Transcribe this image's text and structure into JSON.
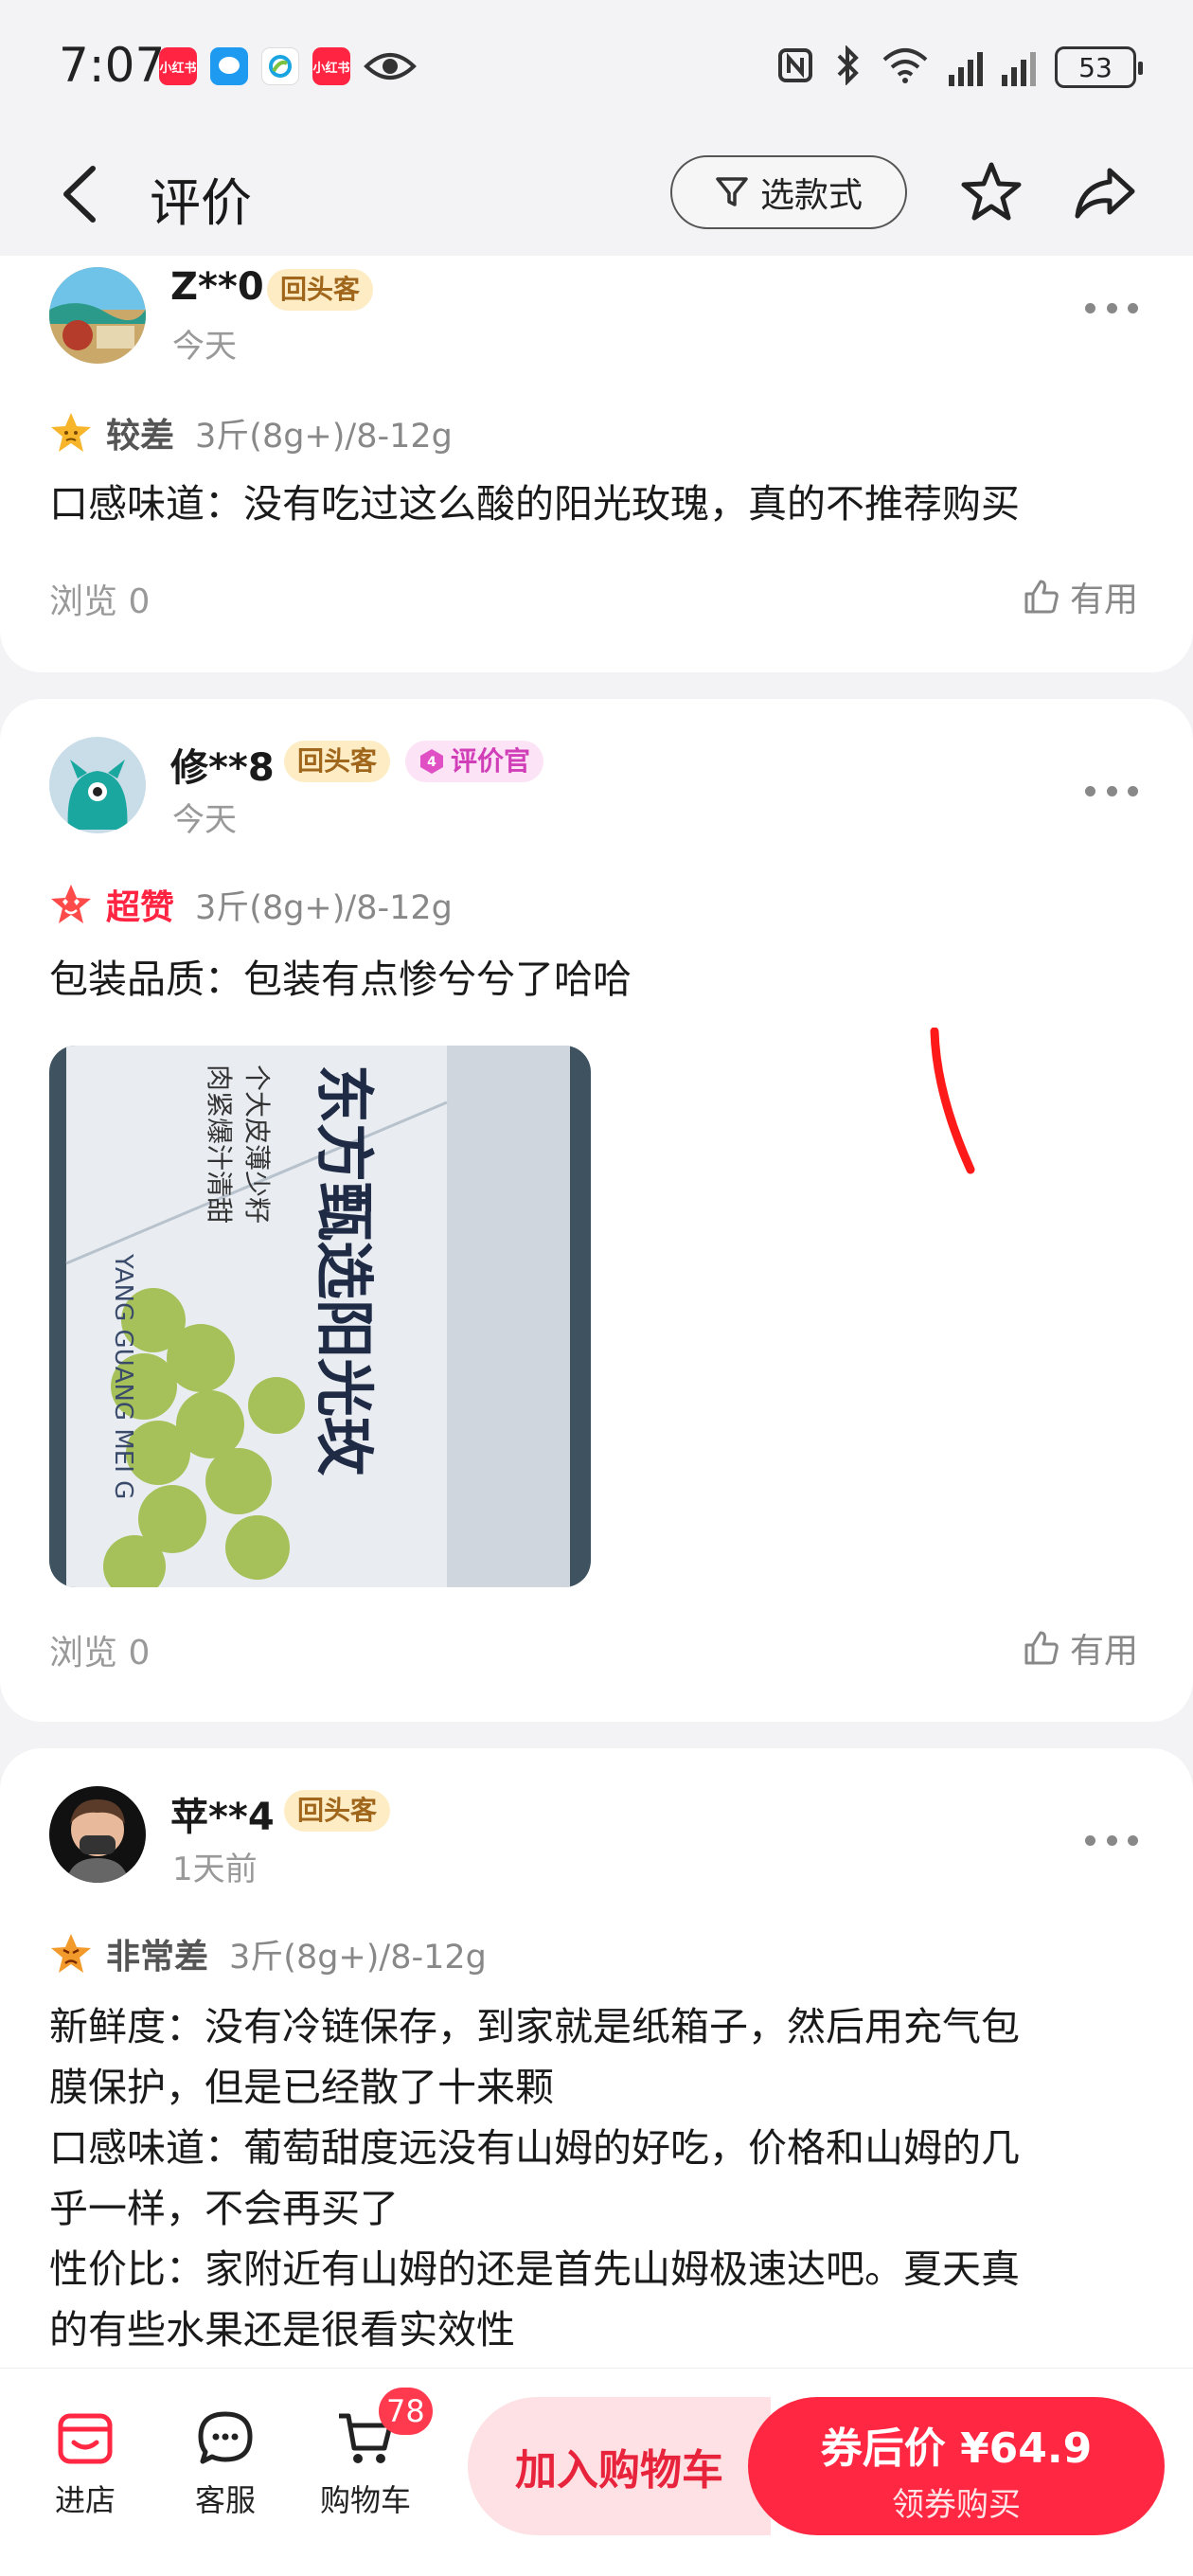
{
  "status_bar": {
    "time": "7:07",
    "app_icons": [
      {
        "name": "xiaohongshu-icon",
        "label": "小红书",
        "color": "#ff2442"
      },
      {
        "name": "message-icon",
        "label": "",
        "color": "#1e9bf0"
      },
      {
        "name": "china-mobile-icon",
        "label": "",
        "color": "#ffffff"
      },
      {
        "name": "xiaohongshu-icon",
        "label": "小红书",
        "color": "#ff2442"
      }
    ],
    "battery": "53"
  },
  "header": {
    "title": "评价",
    "filter_label": "选款式"
  },
  "reviews": [
    {
      "user": "Z**0",
      "badges": [
        "回头客"
      ],
      "time": "今天",
      "rating_word": "较差",
      "rating_color": "#555555",
      "spec": "3斤(8g+)/8-12g",
      "lines": [
        "口感味道：没有吃过这么酸的阳光玫瑰，真的不推荐购买"
      ],
      "views": "浏览 0",
      "useful": "有用"
    },
    {
      "user": "修**8",
      "badges": [
        "回头客"
      ],
      "critic_level": "4",
      "critic_badge": "评价官",
      "time": "今天",
      "rating_word": "超赞",
      "rating_color": "#ff2442",
      "spec": "3斤(8g+)/8-12g",
      "lines": [
        "包装品质：包装有点惨兮兮了哈哈"
      ],
      "photo_text": {
        "main": "东方甄选阳光玫",
        "sub1": "个大皮薄少籽",
        "sub2": "肉紧爆汁清甜",
        "side": "YANG GUANG MEI G"
      },
      "views": "浏览 0",
      "useful": "有用"
    },
    {
      "user": "苹**4",
      "badges": [
        "回头客"
      ],
      "time": "1天前",
      "rating_word": "非常差",
      "rating_color": "#555555",
      "spec": "3斤(8g+)/8-12g",
      "lines": [
        "新鲜度：没有冷链保存，到家就是纸箱子，然后用充气包",
        "膜保护，但是已经散了十来颗",
        "口感味道：葡萄甜度远没有山姆的好吃，价格和山姆的几",
        "乎一样，不会再买了",
        "性价比：家附近有山姆的还是首先山姆极速达吧。夏天真",
        "的有些水果还是很看实效性"
      ]
    }
  ],
  "bottom_bar": {
    "store_label": "进店",
    "service_label": "客服",
    "cart_label": "购物车",
    "cart_count": "78",
    "add_cart_label": "加入购物车",
    "price_label": "券后价 ¥64.9",
    "buy_label": "领券购买"
  },
  "colors": {
    "accent": "#ff2742",
    "background": "#f3f3f5"
  }
}
